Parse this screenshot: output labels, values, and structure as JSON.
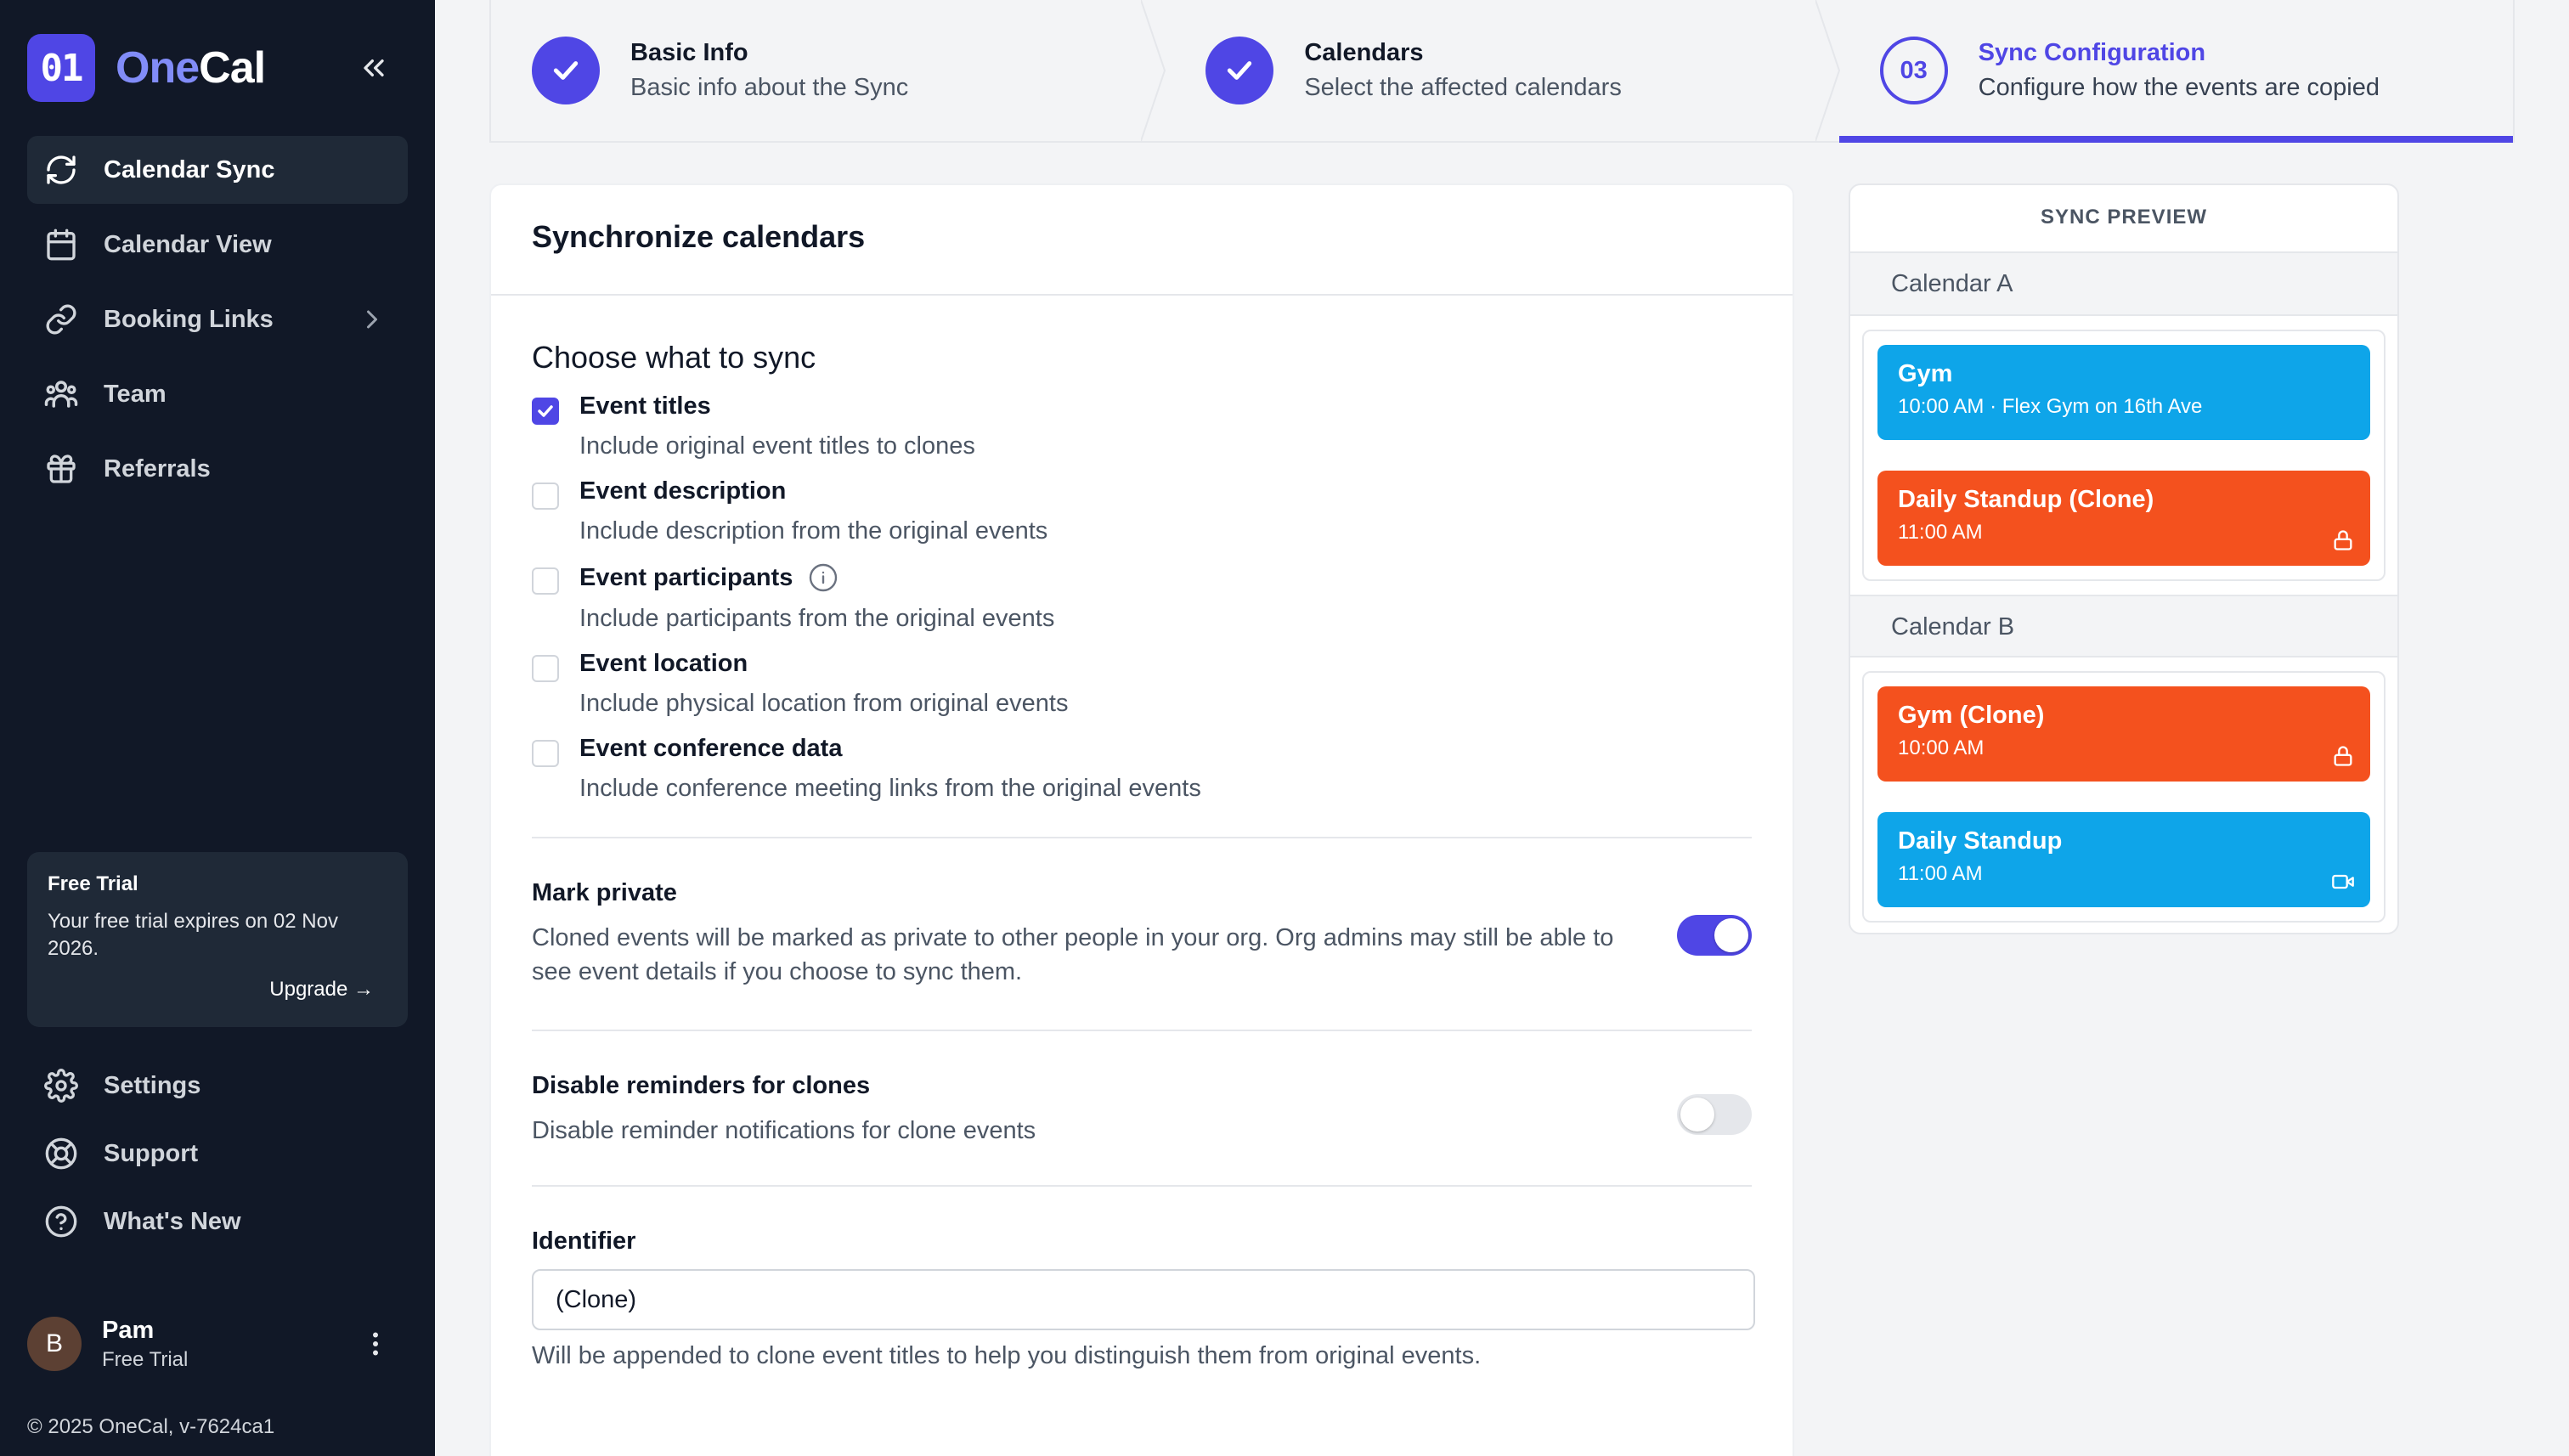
{
  "app": {
    "logo_mark": "01",
    "logo_one": "One",
    "logo_cal": "Cal"
  },
  "sidebar": {
    "items": [
      {
        "label": "Calendar Sync",
        "icon": "sync-icon",
        "active": true
      },
      {
        "label": "Calendar View",
        "icon": "calendar-icon"
      },
      {
        "label": "Booking Links",
        "icon": "link-icon",
        "has_chevron": true
      },
      {
        "label": "Team",
        "icon": "team-icon"
      },
      {
        "label": "Referrals",
        "icon": "gift-icon"
      }
    ],
    "trial": {
      "title": "Free Trial",
      "text": "Your free trial expires on 02 Nov 2026.",
      "upgrade": "Upgrade →"
    },
    "bottom_items": [
      {
        "label": "Settings",
        "icon": "gear-icon"
      },
      {
        "label": "Support",
        "icon": "lifebuoy-icon"
      },
      {
        "label": "What's New",
        "icon": "question-icon"
      }
    ],
    "user": {
      "initial": "B",
      "name": "Pam",
      "plan": "Free Trial"
    },
    "copyright": "© 2025 OneCal, v-7624ca1"
  },
  "stepper": {
    "steps": [
      {
        "title": "Basic Info",
        "subtitle": "Basic info about the Sync",
        "state": "complete"
      },
      {
        "title": "Calendars",
        "subtitle": "Select the affected calendars",
        "state": "complete"
      },
      {
        "number": "03",
        "title": "Sync Configuration",
        "subtitle": "Configure how the events are copied",
        "state": "current"
      }
    ]
  },
  "card": {
    "title": "Synchronize calendars",
    "section_title": "Choose what to sync",
    "options": [
      {
        "label": "Event titles",
        "desc": "Include original event titles to clones",
        "checked": true
      },
      {
        "label": "Event description",
        "desc": "Include description from the original events",
        "checked": false
      },
      {
        "label": "Event participants",
        "desc": "Include participants from the original events",
        "checked": false,
        "info": true
      },
      {
        "label": "Event location",
        "desc": "Include physical location from original events",
        "checked": false
      },
      {
        "label": "Event conference data",
        "desc": "Include conference meeting links from the original events",
        "checked": false
      }
    ],
    "mark_private": {
      "title": "Mark private",
      "desc": "Cloned events will be marked as private to other people in your org. Org admins may still be able to see event details if you choose to sync them.",
      "on": true
    },
    "disable_reminders": {
      "title": "Disable reminders for clones",
      "desc": "Disable reminder notifications for clone events",
      "on": false
    },
    "identifier": {
      "label": "Identifier",
      "value": "(Clone)",
      "help": "Will be appended to clone event titles to help you distinguish them from original events."
    }
  },
  "preview": {
    "title": "SYNC PREVIEW",
    "calendar_a": {
      "label": "Calendar A",
      "events": [
        {
          "title": "Gym",
          "sub": "10:00 AM · Flex Gym on 16th Ave",
          "color": "#0ea5e9"
        },
        {
          "title": "Daily Standup (Clone)",
          "sub": "11:00 AM",
          "color": "#f4511e",
          "icon": "lock-icon"
        }
      ]
    },
    "calendar_b": {
      "label": "Calendar B",
      "events": [
        {
          "title": "Gym (Clone)",
          "sub": "10:00 AM",
          "color": "#f4511e",
          "icon": "lock-icon"
        },
        {
          "title": "Daily Standup",
          "sub": "11:00 AM",
          "color": "#0ea5e9",
          "icon": "video-icon"
        }
      ]
    }
  },
  "colors": {
    "accent": "#4f46e5",
    "sidebar_bg": "#111827",
    "clone_event": "#f4511e",
    "original_event": "#0ea5e9"
  }
}
